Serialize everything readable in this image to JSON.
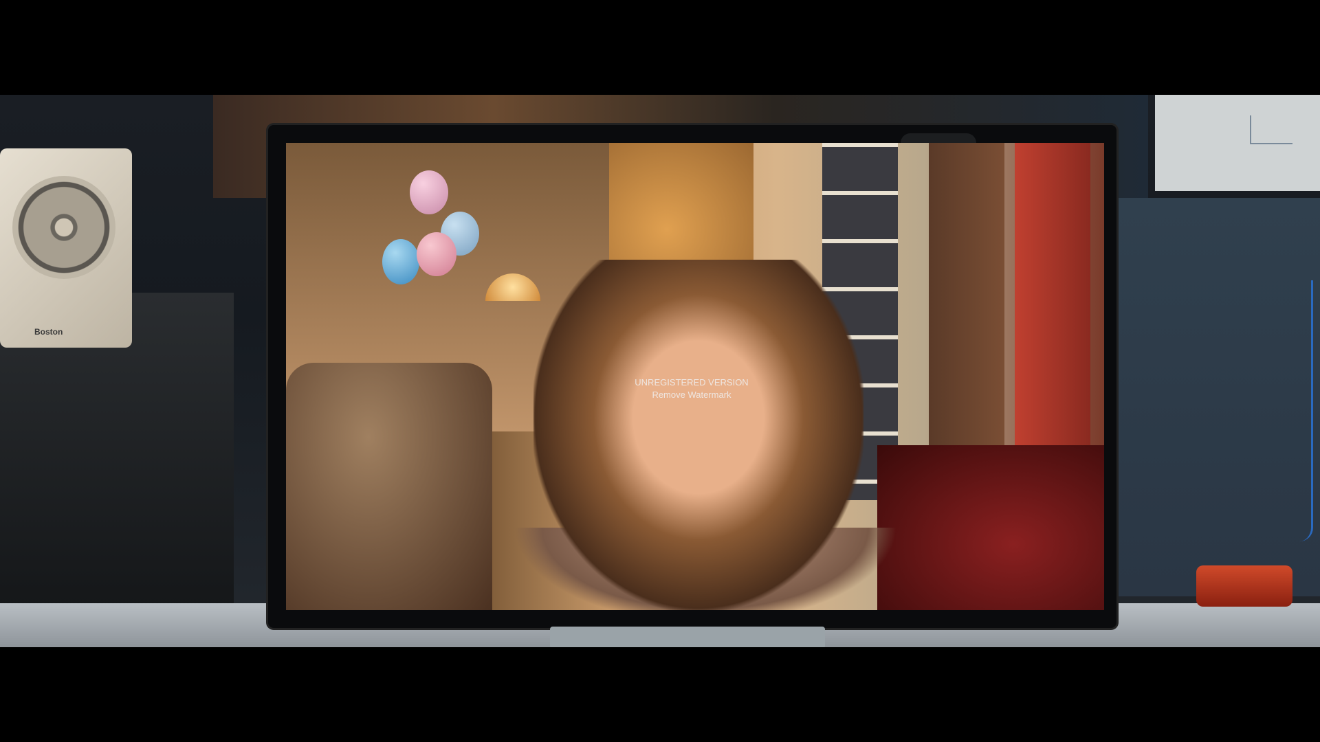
{
  "watermark": {
    "line1": "UNREGISTERED VERSION",
    "line2": "Remove Watermark"
  },
  "speaker": {
    "brand": "Boston"
  },
  "colors": {
    "letterbox": "#000000",
    "watermark_text": "#f0f0f0"
  }
}
